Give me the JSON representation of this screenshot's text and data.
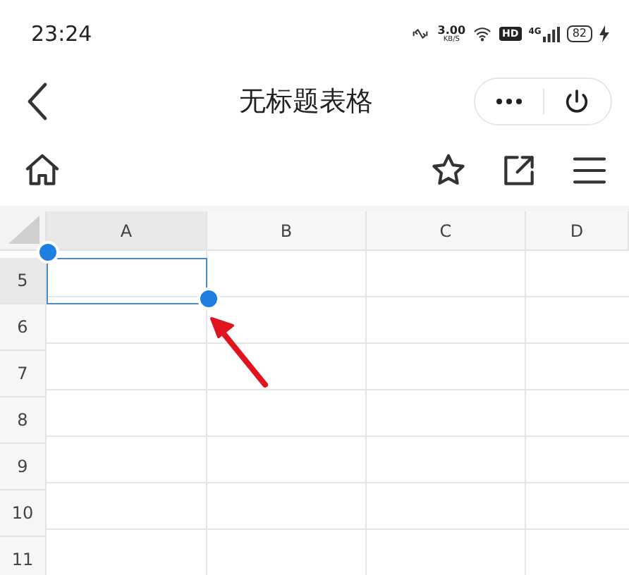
{
  "status_bar": {
    "time": "23:24",
    "net_speed": "3.00",
    "net_unit": "KB/S",
    "hd_badge": "HD",
    "network": "4G",
    "battery": "82"
  },
  "title_bar": {
    "title": "无标题表格"
  },
  "sheet": {
    "columns": [
      {
        "label": "A",
        "selected": true
      },
      {
        "label": "B",
        "selected": false
      },
      {
        "label": "C",
        "selected": false
      },
      {
        "label": "D",
        "selected": false
      }
    ],
    "rows": [
      {
        "label": "5",
        "selected": true
      },
      {
        "label": "6",
        "selected": false
      },
      {
        "label": "7",
        "selected": false
      },
      {
        "label": "8",
        "selected": false
      },
      {
        "label": "9",
        "selected": false
      },
      {
        "label": "10",
        "selected": false
      },
      {
        "label": "11",
        "selected": false
      }
    ]
  }
}
